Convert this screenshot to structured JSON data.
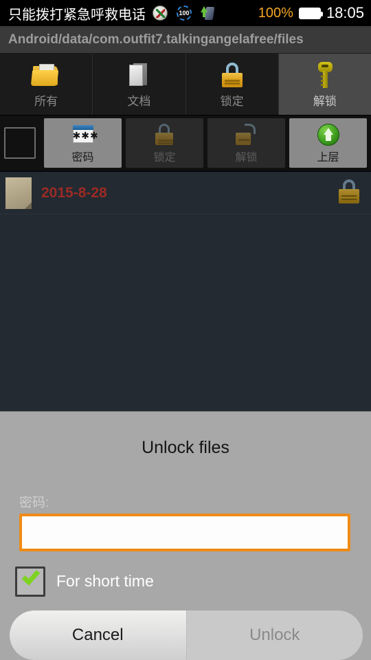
{
  "status_bar": {
    "carrier_text": "只能拨打紧急呼救电话",
    "icons": [
      {
        "name": "compass-icon",
        "glyph": "compass"
      },
      {
        "name": "battery-circle-100-icon",
        "glyph": "100"
      },
      {
        "name": "phone-upload-icon",
        "glyph": "phone-up"
      }
    ],
    "battery_percent": "100%",
    "battery_icon": "battery-full-icon",
    "clock": "18:05"
  },
  "path_bar": {
    "path": "Android/data/com.outfit7.talkingangelafree/files"
  },
  "tabs": [
    {
      "label": "所有",
      "icon": "folder-icon",
      "selected": false
    },
    {
      "label": "文档",
      "icon": "documents-icon",
      "selected": false
    },
    {
      "label": "锁定",
      "icon": "padlock-closed-icon",
      "selected": false
    },
    {
      "label": "解锁",
      "icon": "key-icon",
      "selected": true
    }
  ],
  "action_bar": {
    "select_all_checkbox": {
      "name": "select-all-checkbox",
      "checked": false
    },
    "buttons": [
      {
        "label": "密码",
        "icon": "password-window-icon",
        "enabled": true
      },
      {
        "label": "锁定",
        "icon": "padlock-closed-icon",
        "enabled": false
      },
      {
        "label": "解锁",
        "icon": "padlock-open-icon",
        "enabled": false
      },
      {
        "label": "上层",
        "icon": "up-level-arrow-icon",
        "enabled": true
      }
    ]
  },
  "file_list": {
    "rows": [
      {
        "name": "2015-8-28",
        "thumbnail": "file-thumbnail",
        "status_icon": "padlock-closed-icon"
      }
    ]
  },
  "dialog": {
    "title": "Unlock files",
    "password_label": "密码:",
    "password_value": "",
    "password_placeholder": "",
    "short_time_label": "For short time",
    "short_time_checked": true,
    "cancel_label": "Cancel",
    "unlock_label": "Unlock",
    "unlock_enabled": false
  },
  "colors": {
    "accent_orange": "#ef8b16",
    "background_dark": "#232a31",
    "dialog_gray": "#a8a8a8",
    "file_name_red": "#9c2a25",
    "battery_orange": "#f5a623",
    "check_green": "#7ed321"
  }
}
